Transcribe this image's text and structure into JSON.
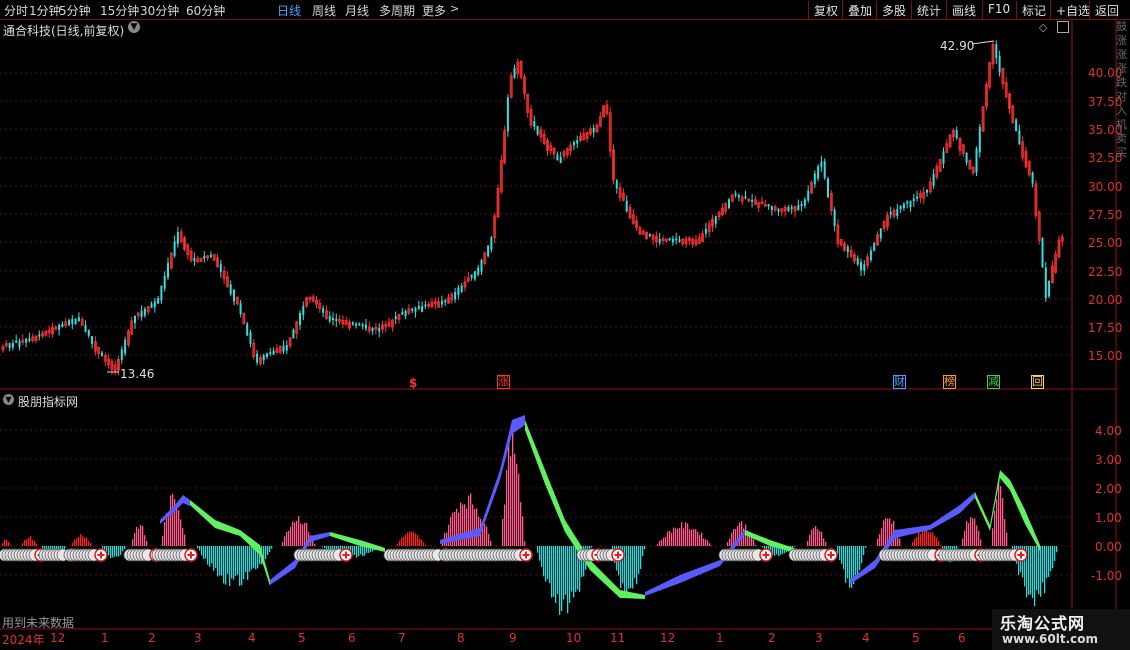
{
  "toolbar": {
    "left": [
      {
        "label": "分时",
        "active": false
      },
      {
        "label": "1分钟",
        "active": false
      },
      {
        "label": "5分钟",
        "active": false
      },
      {
        "label": "15分钟",
        "active": false
      },
      {
        "label": "30分钟",
        "active": false
      },
      {
        "label": "60分钟",
        "active": false
      },
      {
        "label": "日线",
        "active": true
      },
      {
        "label": "周线",
        "active": false
      },
      {
        "label": "月线",
        "active": false
      },
      {
        "label": "多周期",
        "active": false
      },
      {
        "label": "更多",
        "active": false
      }
    ],
    "right": [
      "复权",
      "叠加",
      "多股",
      "统计",
      "画线",
      "F10",
      "标记",
      "+自选",
      "返回"
    ]
  },
  "main_chart": {
    "title": "通合科技(日线,前复权)",
    "price_ticks": [
      "40.00",
      "37.50",
      "35.00",
      "32.50",
      "30.00",
      "27.50",
      "25.00",
      "22.50",
      "20.00",
      "17.50",
      "15.00"
    ],
    "high_label": "42.90",
    "low_label": "13.46",
    "markers": [
      {
        "text": "$",
        "color": "#ff3030"
      },
      {
        "text": "涨",
        "color": "#ff3030"
      },
      {
        "text": "财",
        "color": "#4aa0ff"
      },
      {
        "text": "榜",
        "color": "#ff9a30"
      },
      {
        "text": "减",
        "color": "#40d040"
      },
      {
        "text": "回",
        "color": "#ffd070"
      }
    ]
  },
  "indicator": {
    "title": "股朋指标网",
    "ticks": [
      "4.00",
      "3.00",
      "2.00",
      "1.00",
      "0.00",
      "-1.00"
    ],
    "footnote": "用到未来数据"
  },
  "time_axis": {
    "labels": [
      "2024年",
      "12",
      "1",
      "2",
      "3",
      "4",
      "5",
      "6",
      "7",
      "8",
      "9",
      "10",
      "11",
      "12",
      "1",
      "2",
      "3",
      "4",
      "5",
      "6"
    ]
  },
  "watermark": {
    "line1": "乐淘公式网",
    "line2": "www.60lt.com"
  },
  "right_strip": "鼓涨涨涨跌对入机卖买"
}
